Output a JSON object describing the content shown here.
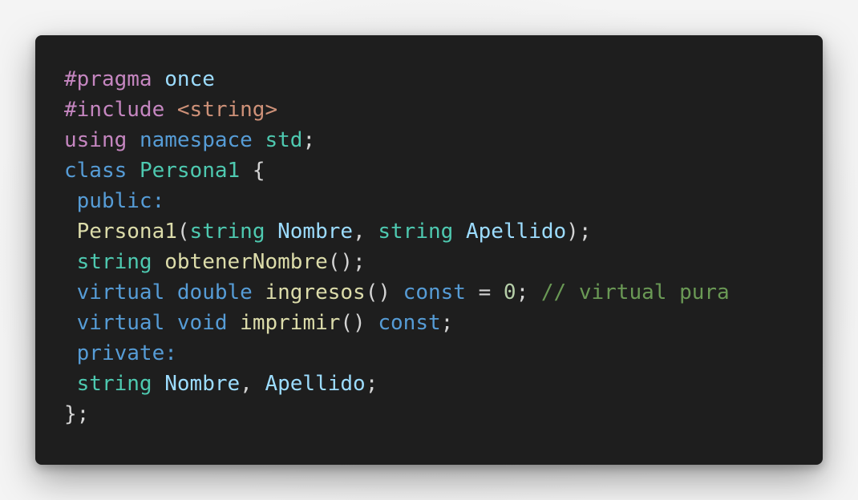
{
  "code": {
    "lines": [
      [
        {
          "text": "#pragma",
          "kind": "preproc"
        },
        {
          "text": " ",
          "kind": "plain"
        },
        {
          "text": "once",
          "kind": "macro"
        }
      ],
      [
        {
          "text": "#include",
          "kind": "preproc"
        },
        {
          "text": " ",
          "kind": "plain"
        },
        {
          "text": "<string>",
          "kind": "string"
        }
      ],
      [
        {
          "text": "using",
          "kind": "control"
        },
        {
          "text": " ",
          "kind": "plain"
        },
        {
          "text": "namespace",
          "kind": "keyword"
        },
        {
          "text": " ",
          "kind": "plain"
        },
        {
          "text": "std",
          "kind": "type"
        },
        {
          "text": ";",
          "kind": "punct"
        }
      ],
      [
        {
          "text": "class",
          "kind": "keyword"
        },
        {
          "text": " ",
          "kind": "plain"
        },
        {
          "text": "Persona1",
          "kind": "type"
        },
        {
          "text": " {",
          "kind": "punct"
        }
      ],
      [
        {
          "text": " ",
          "kind": "plain"
        },
        {
          "text": "public:",
          "kind": "keyword"
        }
      ],
      [
        {
          "text": " ",
          "kind": "plain"
        },
        {
          "text": "Persona1",
          "kind": "function"
        },
        {
          "text": "(",
          "kind": "punct"
        },
        {
          "text": "string",
          "kind": "type"
        },
        {
          "text": " ",
          "kind": "plain"
        },
        {
          "text": "Nombre",
          "kind": "variable"
        },
        {
          "text": ", ",
          "kind": "punct"
        },
        {
          "text": "string",
          "kind": "type"
        },
        {
          "text": " ",
          "kind": "plain"
        },
        {
          "text": "Apellido",
          "kind": "variable"
        },
        {
          "text": ");",
          "kind": "punct"
        }
      ],
      [
        {
          "text": " ",
          "kind": "plain"
        },
        {
          "text": "string",
          "kind": "type"
        },
        {
          "text": " ",
          "kind": "plain"
        },
        {
          "text": "obtenerNombre",
          "kind": "function"
        },
        {
          "text": "();",
          "kind": "punct"
        }
      ],
      [
        {
          "text": " ",
          "kind": "plain"
        },
        {
          "text": "virtual",
          "kind": "keyword"
        },
        {
          "text": " ",
          "kind": "plain"
        },
        {
          "text": "double",
          "kind": "keyword"
        },
        {
          "text": " ",
          "kind": "plain"
        },
        {
          "text": "ingresos",
          "kind": "function"
        },
        {
          "text": "() ",
          "kind": "punct"
        },
        {
          "text": "const",
          "kind": "keyword"
        },
        {
          "text": " = ",
          "kind": "punct"
        },
        {
          "text": "0",
          "kind": "number"
        },
        {
          "text": "; ",
          "kind": "punct"
        },
        {
          "text": "// virtual pura",
          "kind": "comment"
        }
      ],
      [
        {
          "text": " ",
          "kind": "plain"
        },
        {
          "text": "virtual",
          "kind": "keyword"
        },
        {
          "text": " ",
          "kind": "plain"
        },
        {
          "text": "void",
          "kind": "keyword"
        },
        {
          "text": " ",
          "kind": "plain"
        },
        {
          "text": "imprimir",
          "kind": "function"
        },
        {
          "text": "() ",
          "kind": "punct"
        },
        {
          "text": "const",
          "kind": "keyword"
        },
        {
          "text": ";",
          "kind": "punct"
        }
      ],
      [
        {
          "text": " ",
          "kind": "plain"
        },
        {
          "text": "private:",
          "kind": "keyword"
        }
      ],
      [
        {
          "text": " ",
          "kind": "plain"
        },
        {
          "text": "string",
          "kind": "type"
        },
        {
          "text": " ",
          "kind": "plain"
        },
        {
          "text": "Nombre",
          "kind": "variable"
        },
        {
          "text": ", ",
          "kind": "punct"
        },
        {
          "text": "Apellido",
          "kind": "variable"
        },
        {
          "text": ";",
          "kind": "punct"
        }
      ],
      [
        {
          "text": "};",
          "kind": "punct"
        }
      ]
    ]
  },
  "colors": {
    "page_background": "#ececec",
    "editor_background": "#1e1e1e",
    "preproc": "#c586c0",
    "keyword": "#569cd6",
    "type": "#4ec9b0",
    "function": "#dcdcaa",
    "variable": "#9cdcfe",
    "string": "#ce9178",
    "number": "#b5cea8",
    "comment": "#6a9955",
    "punctuation": "#d4d4d4"
  }
}
